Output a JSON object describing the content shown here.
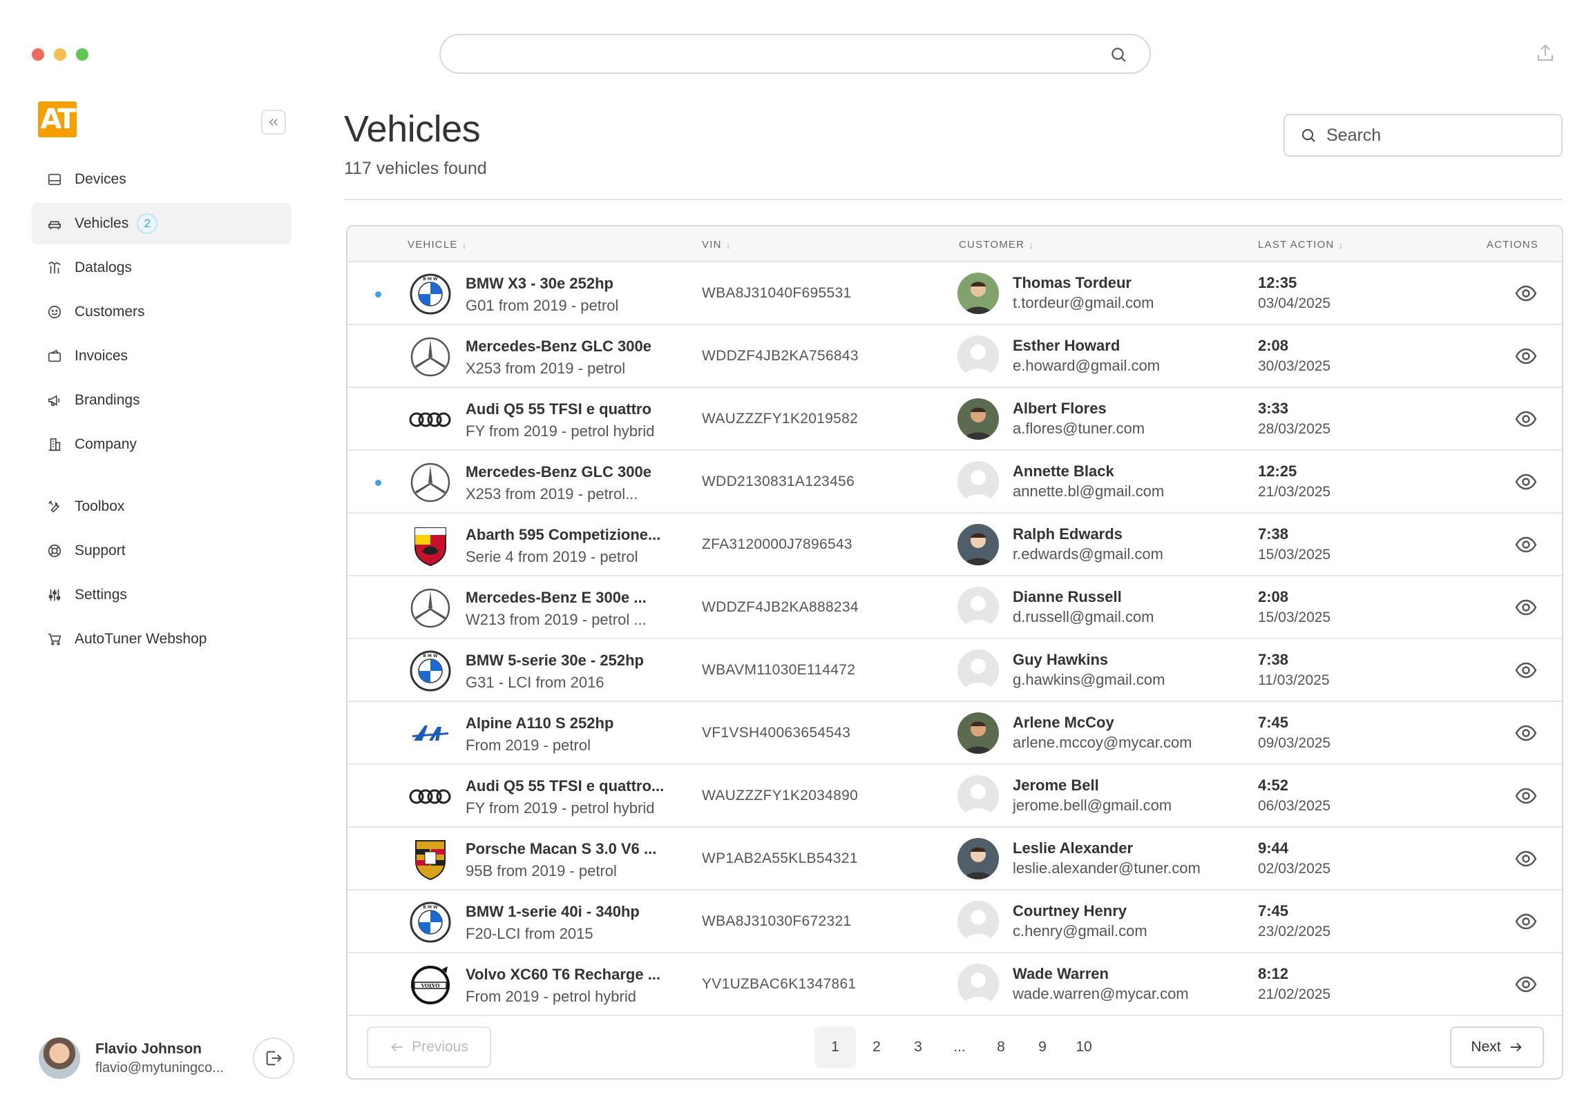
{
  "app": {
    "logo_text": "AT",
    "top_search_placeholder": "",
    "colors": {
      "accent": "#3aa6dd",
      "brand": "#f5a000"
    }
  },
  "sidebar": {
    "items": [
      {
        "label": "Devices",
        "icon": "device-icon",
        "active": false
      },
      {
        "label": "Vehicles",
        "icon": "car-icon",
        "active": true,
        "badge": "2"
      },
      {
        "label": "Datalogs",
        "icon": "datalog-icon",
        "active": false
      },
      {
        "label": "Customers",
        "icon": "smiley-icon",
        "active": false
      },
      {
        "label": "Invoices",
        "icon": "wallet-icon",
        "active": false
      },
      {
        "label": "Brandings",
        "icon": "megaphone-icon",
        "active": false
      },
      {
        "label": "Company",
        "icon": "building-icon",
        "active": false
      }
    ],
    "secondary_items": [
      {
        "label": "Toolbox",
        "icon": "tools-icon"
      },
      {
        "label": "Support",
        "icon": "lifebuoy-icon"
      },
      {
        "label": "Settings",
        "icon": "sliders-icon"
      },
      {
        "label": "AutoTuner Webshop",
        "icon": "cart-icon"
      }
    ],
    "user": {
      "name": "Flavio Johnson",
      "email": "flavio@mytuningco..."
    }
  },
  "header": {
    "title": "Vehicles",
    "subtitle": "117 vehicles found",
    "search_placeholder": "Search"
  },
  "table": {
    "columns": {
      "vehicle": "VEHICLE",
      "vin": "VIN",
      "customer": "CUSTOMER",
      "last_action": "LAST ACTION",
      "actions": "ACTIONS"
    },
    "rows": [
      {
        "brand": "bmw",
        "unread": true,
        "name": "BMW X3 - 30e 252hp",
        "desc": "G01 from 2019 - petrol",
        "vin": "WBA8J31040F695531",
        "customer": "Thomas Tordeur",
        "email": "t.tordeur@gmail.com",
        "photo": true,
        "time": "12:35",
        "date": "03/04/2025"
      },
      {
        "brand": "mercedes",
        "unread": false,
        "name": "Mercedes-Benz GLC 300e",
        "desc": "X253 from 2019 - petrol",
        "vin": "WDDZF4JB2KA756843",
        "customer": "Esther Howard",
        "email": "e.howard@gmail.com",
        "photo": false,
        "time": "2:08",
        "date": "30/03/2025"
      },
      {
        "brand": "audi",
        "unread": false,
        "name": "Audi Q5 55 TFSI e quattro",
        "desc": "FY from 2019 - petrol hybrid",
        "vin": "WAUZZZFY1K2019582",
        "customer": "Albert Flores",
        "email": "a.flores@tuner.com",
        "photo": true,
        "time": "3:33",
        "date": "28/03/2025"
      },
      {
        "brand": "mercedes",
        "unread": true,
        "name": "Mercedes-Benz GLC 300e",
        "desc": "X253 from 2019 - petrol...",
        "vin": "WDD2130831A123456",
        "customer": "Annette Black",
        "email": "annette.bl@gmail.com",
        "photo": false,
        "time": "12:25",
        "date": "21/03/2025"
      },
      {
        "brand": "abarth",
        "unread": false,
        "name": "Abarth 595 Competizione...",
        "desc": "Serie 4 from 2019 - petrol",
        "vin": "ZFA3120000J7896543",
        "customer": "Ralph Edwards",
        "email": "r.edwards@gmail.com",
        "photo": true,
        "time": "7:38",
        "date": "15/03/2025"
      },
      {
        "brand": "mercedes",
        "unread": false,
        "name": "Mercedes-Benz E 300e ...",
        "desc": "W213 from 2019 - petrol ...",
        "vin": "WDDZF4JB2KA888234",
        "customer": "Dianne Russell",
        "email": "d.russell@gmail.com",
        "photo": false,
        "time": "2:08",
        "date": "15/03/2025"
      },
      {
        "brand": "bmw",
        "unread": false,
        "name": "BMW 5-serie 30e - 252hp",
        "desc": "G31 - LCI from 2016",
        "vin": "WBAVM11030E114472",
        "customer": "Guy Hawkins",
        "email": "g.hawkins@gmail.com",
        "photo": false,
        "time": "7:38",
        "date": "11/03/2025"
      },
      {
        "brand": "alpine",
        "unread": false,
        "name": "Alpine A110 S 252hp",
        "desc": "From 2019 - petrol",
        "vin": "VF1VSH40063654543",
        "customer": "Arlene McCoy",
        "email": "arlene.mccoy@mycar.com",
        "photo": true,
        "time": "7:45",
        "date": "09/03/2025"
      },
      {
        "brand": "audi",
        "unread": false,
        "name": "Audi Q5 55 TFSI e quattro...",
        "desc": "FY from 2019 - petrol hybrid",
        "vin": "WAUZZZFY1K2034890",
        "customer": "Jerome Bell",
        "email": "jerome.bell@gmail.com",
        "photo": false,
        "time": "4:52",
        "date": "06/03/2025"
      },
      {
        "brand": "porsche",
        "unread": false,
        "name": "Porsche Macan S 3.0 V6 ...",
        "desc": "95B from 2019 - petrol",
        "vin": "WP1AB2A55KLB54321",
        "customer": "Leslie Alexander",
        "email": "leslie.alexander@tuner.com",
        "photo": true,
        "time": "9:44",
        "date": "02/03/2025"
      },
      {
        "brand": "bmw",
        "unread": false,
        "name": "BMW 1-serie 40i - 340hp",
        "desc": "F20-LCI from 2015",
        "vin": "WBA8J31030F672321",
        "customer": "Courtney Henry",
        "email": "c.henry@gmail.com",
        "photo": false,
        "time": "7:45",
        "date": "23/02/2025"
      },
      {
        "brand": "volvo",
        "unread": false,
        "name": "Volvo XC60 T6 Recharge ...",
        "desc": "From 2019 - petrol hybrid",
        "vin": "YV1UZBAC6K1347861",
        "customer": "Wade Warren",
        "email": "wade.warren@mycar.com",
        "photo": false,
        "time": "8:12",
        "date": "21/02/2025"
      }
    ]
  },
  "pagination": {
    "prev_label": "Previous",
    "next_label": "Next",
    "pages": [
      "1",
      "2",
      "3",
      "...",
      "8",
      "9",
      "10"
    ],
    "current": "1"
  }
}
